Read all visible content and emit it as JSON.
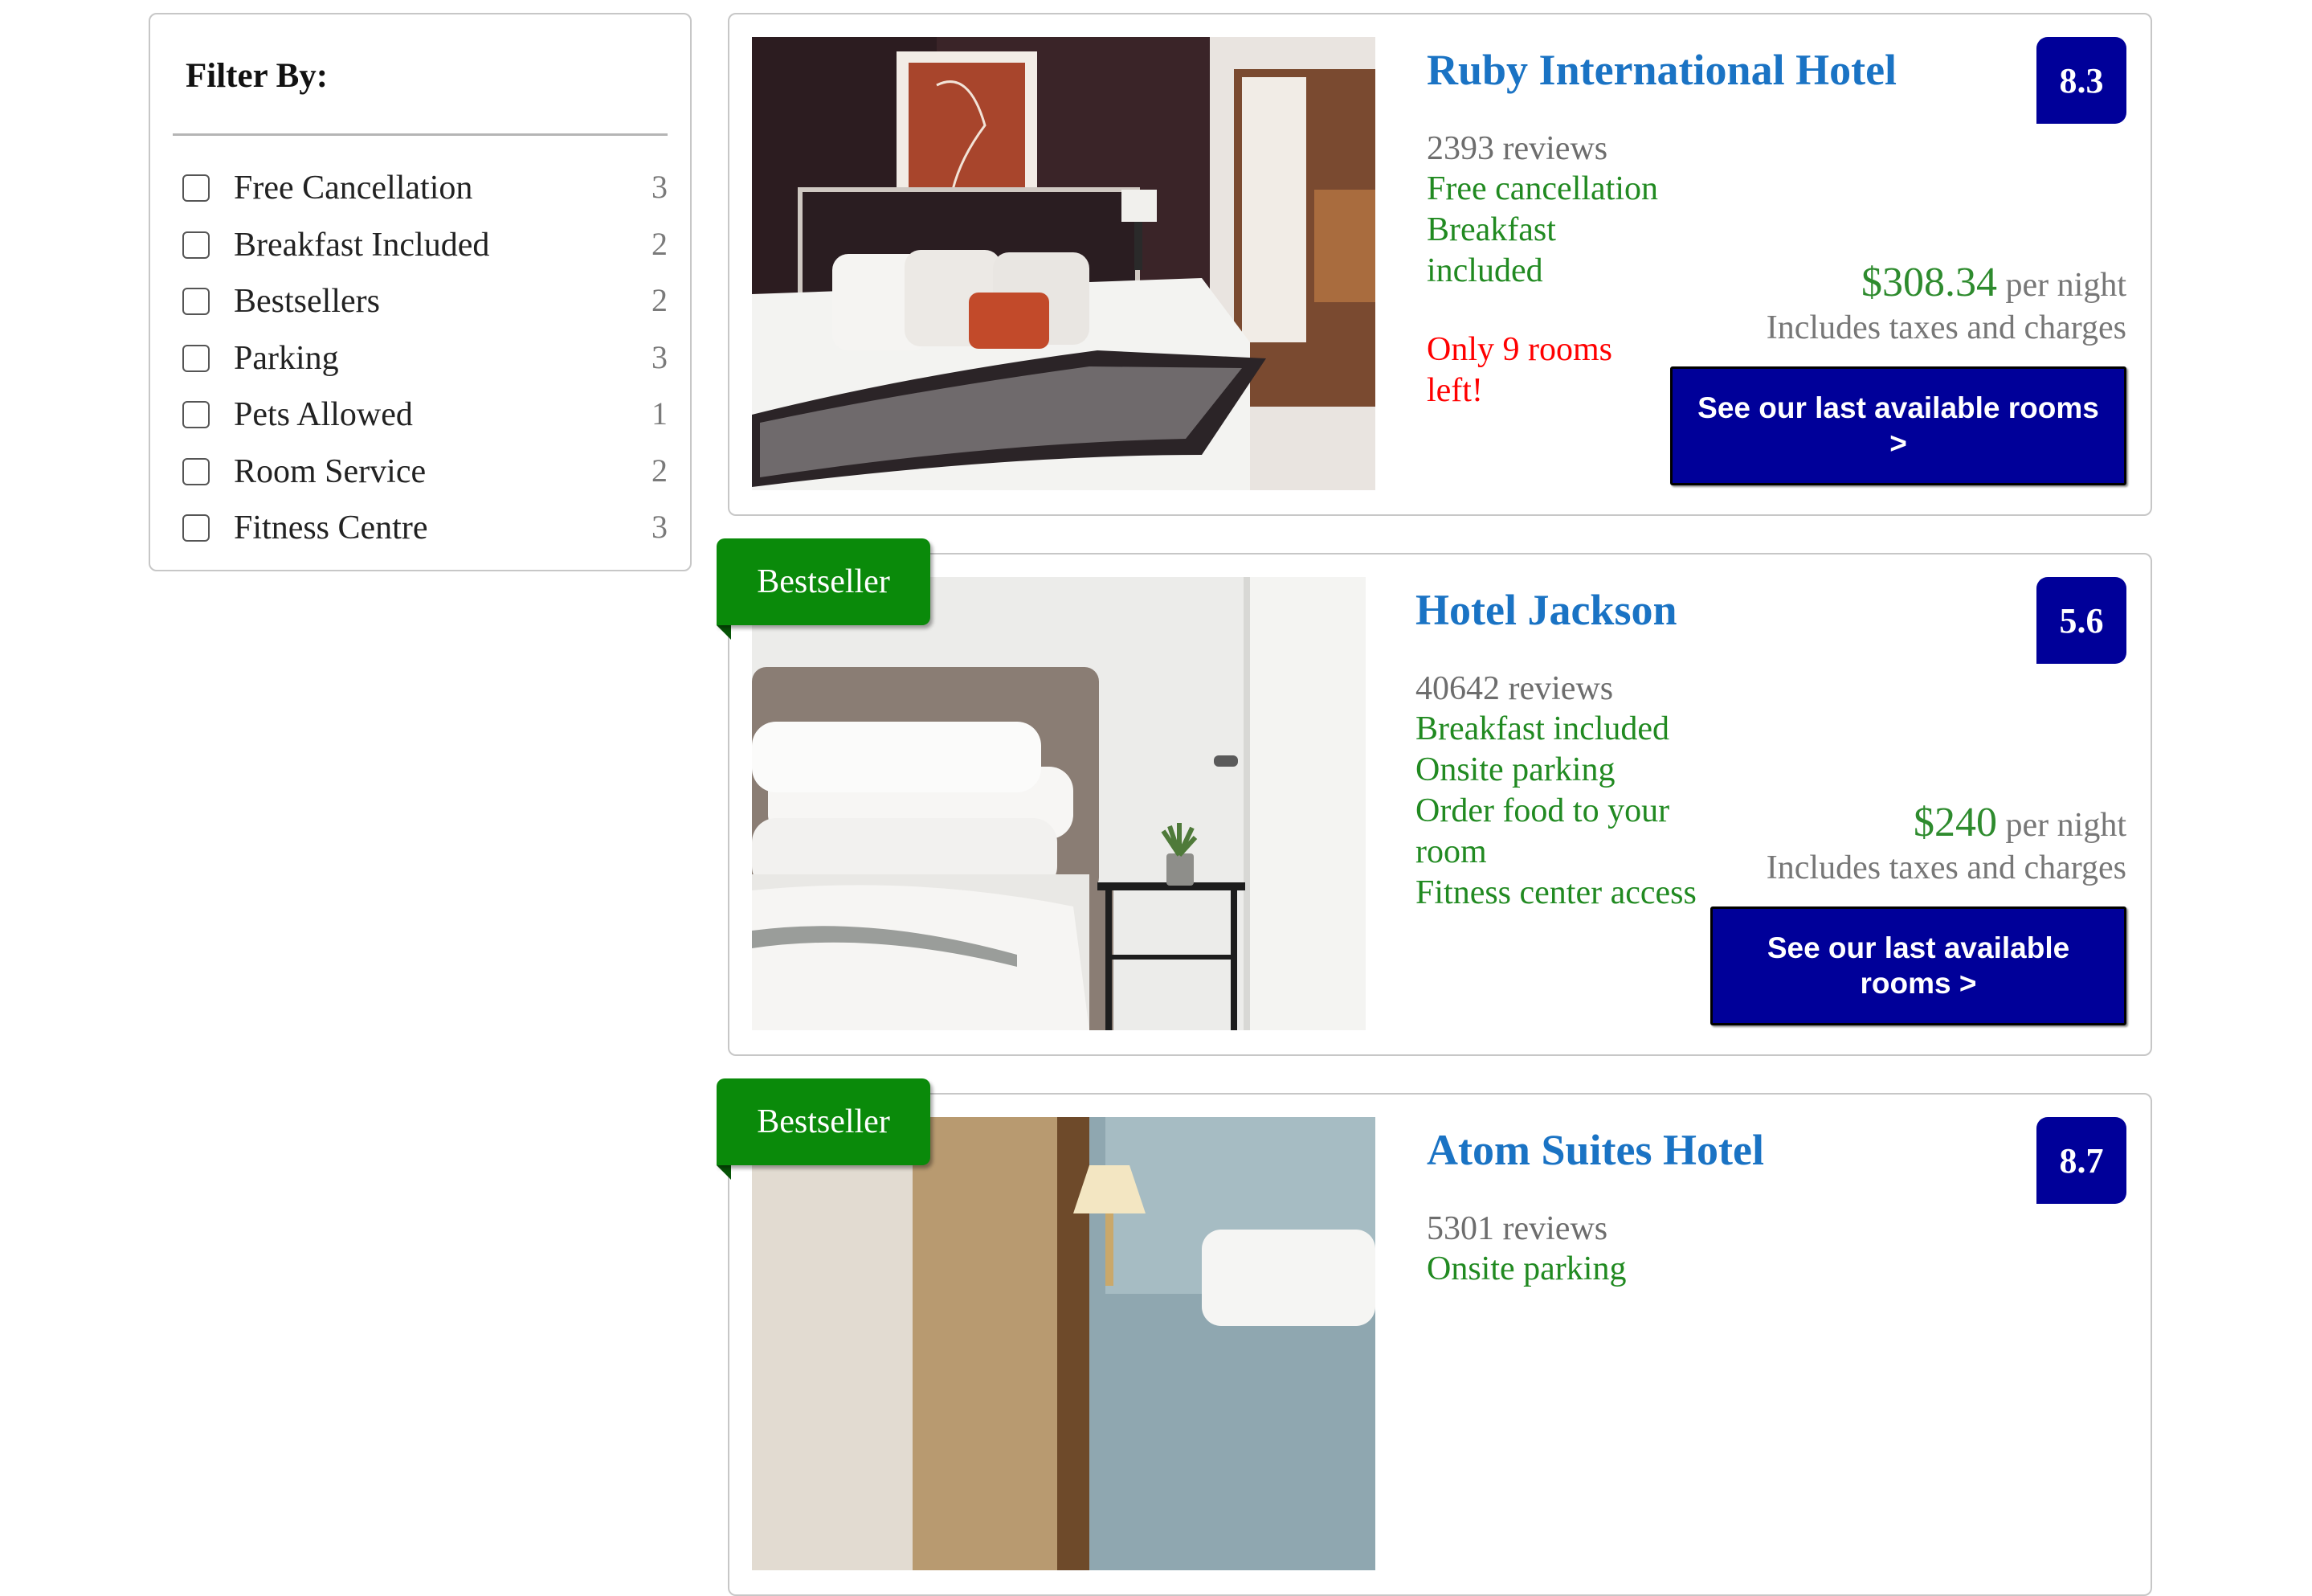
{
  "filter": {
    "title": "Filter By:",
    "options": [
      {
        "label": "Free Cancellation",
        "count": "3"
      },
      {
        "label": "Breakfast Included",
        "count": "2"
      },
      {
        "label": "Bestsellers",
        "count": "2"
      },
      {
        "label": "Parking",
        "count": "3"
      },
      {
        "label": "Pets Allowed",
        "count": "1"
      },
      {
        "label": "Room Service",
        "count": "2"
      },
      {
        "label": "Fitness Centre",
        "count": "3"
      }
    ]
  },
  "ribbon_label": "Bestseller",
  "hotels": [
    {
      "name": "Ruby International Hotel",
      "score": "8.3",
      "reviews": "2393 reviews",
      "features": [
        "Free cancellation",
        "Breakfast",
        "included"
      ],
      "scarcity": [
        "Only 9 rooms",
        "left!"
      ],
      "price": "$308.34",
      "per_night": "per night",
      "taxes": "Includes taxes and charges",
      "cta": "See our last available rooms >",
      "bestseller": false
    },
    {
      "name": "Hotel Jackson",
      "score": "5.6",
      "reviews": "40642 reviews",
      "features": [
        "Breakfast included",
        "Onsite parking",
        "Order food to your",
        "room",
        "Fitness center access"
      ],
      "price": "$240",
      "per_night": "per night",
      "taxes": "Includes taxes and charges",
      "cta": "See our last available rooms >",
      "bestseller": true
    },
    {
      "name": "Atom Suites Hotel",
      "score": "8.7",
      "reviews": "5301 reviews",
      "features": [
        "Onsite parking"
      ],
      "bestseller": true
    }
  ],
  "colors": {
    "accent_navy": "#000099",
    "link_blue": "#1a73c4",
    "feature_green": "#218a21",
    "bestseller_green": "#0a8a0a",
    "alert_red": "#ff0000"
  }
}
